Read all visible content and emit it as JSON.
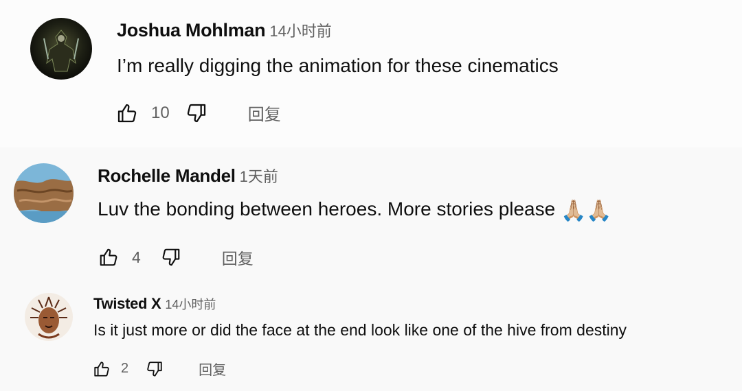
{
  "comments": [
    {
      "author": "Joshua Mohlman",
      "time": "14小时前",
      "text": "I’m really digging the animation for these cinematics",
      "likes": "10",
      "reply_label": "回复",
      "avatar_icon": "dark-armored-figure-avatar"
    },
    {
      "author": "Rochelle Mandel",
      "time": "1天前",
      "text": "Luv the bonding between heroes. More stories please",
      "emoji": "🙏🏼🙏🏼",
      "likes": "4",
      "reply_label": "回复",
      "avatar_icon": "rock-landscape-avatar"
    },
    {
      "author": "Twisted X",
      "time": "14小时前",
      "text": "Is it just more or did the face at the end look like one of the hive from destiny",
      "likes": "2",
      "reply_label": "回复",
      "avatar_icon": "tribal-face-drawing-avatar"
    }
  ],
  "colors": {
    "text_primary": "#0f0f0f",
    "text_secondary": "#606060",
    "background": "#f9f9f9"
  }
}
